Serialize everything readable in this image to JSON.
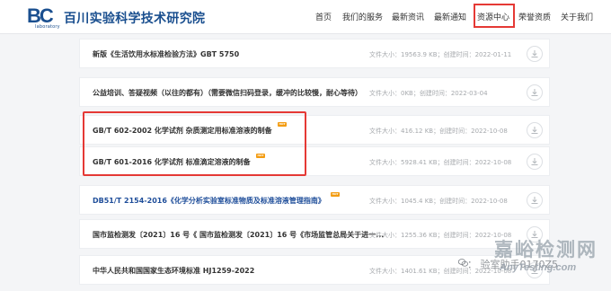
{
  "header": {
    "logo_text": "BC",
    "logo_sub": "laboratory",
    "brand": "百川实验科学技术研究院",
    "nav": [
      "首页",
      "我们的服务",
      "最新资讯",
      "最新通知",
      "资源中心",
      "荣誉资质",
      "关于我们"
    ],
    "active_nav": "资源中心",
    "highlight_color": "#e53935",
    "brand_color": "#1a4f8f"
  },
  "list": {
    "items": [
      {
        "title": "新版《生活饮用水标准检验方法》GBT 5750",
        "meta": "文件大小：19563.9 KB；创建时间：2022-01-11",
        "hot": false,
        "blue": false
      },
      {
        "title": "公益培训、答疑视频（以往的都有）（需要微信扫码登录，缓冲的比较慢，耐心等待）",
        "meta": "文件大小：0KB；创建时间：2022-03-04",
        "hot": false,
        "blue": false
      },
      {
        "title": "GB/T 602-2002 化学试剂 杂质测定用标准溶液的制备",
        "meta": "文件大小：416.12 KB；创建时间：2022-10-08",
        "hot": true,
        "blue": false
      },
      {
        "title": "GB/T 601-2016 化学试剂 标准滴定溶液的制备",
        "meta": "文件大小：5928.41 KB；创建时间：2022-10-08",
        "hot": true,
        "blue": false
      },
      {
        "title": "DB51/T 2154-2016《化学分析实验室标准物质及标准溶液管理指南》",
        "meta": "文件大小：1045.4 KB；创建时间：2022-10-08",
        "hot": true,
        "blue": true
      },
      {
        "title": "国市监检测发〔2021〕16 号《 国市监检测发〔2021〕16 号《市场监管总局关于进一...",
        "meta": "文件大小：1255.36 KB；创建时间：2022-10-08",
        "hot": false,
        "blue": false
      },
      {
        "title": "中华人民共和国国家生态环境标准 HJ1259-2022",
        "meta": "文件大小：1401.61 KB；创建时间：2022-10-08",
        "hot": false,
        "blue": false
      }
    ],
    "hot_label": "HOT",
    "download_icon": "download-icon"
  },
  "watermark": {
    "site": "嘉峪检测网",
    "site_en": "AnyTesting.com",
    "handle": "： 验室助手0170Z5"
  }
}
